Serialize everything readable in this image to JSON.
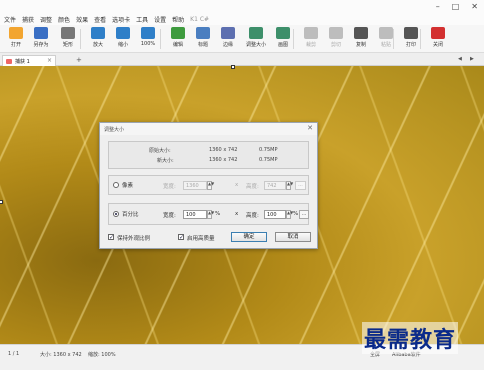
{
  "window": {
    "controls": [
      "–",
      "□",
      "✕"
    ]
  },
  "menu": [
    {
      "label": "文件",
      "dim": false
    },
    {
      "label": "捕获",
      "dim": false
    },
    {
      "label": "调整",
      "dim": false
    },
    {
      "label": "颜色",
      "dim": false
    },
    {
      "label": "效果",
      "dim": false
    },
    {
      "label": "查看",
      "dim": false
    },
    {
      "label": "选项卡",
      "dim": false
    },
    {
      "label": "工具",
      "dim": false
    },
    {
      "label": "设置",
      "dim": false
    },
    {
      "label": "帮助",
      "dim": false
    },
    {
      "label": "K1 C#",
      "dim": true
    }
  ],
  "toolbar": [
    {
      "name": "open",
      "label": "打开",
      "icon": "folder-open-icon",
      "color": "#f2a530",
      "disabled": false
    },
    {
      "name": "save-as",
      "label": "另存为",
      "icon": "save-icon",
      "color": "#3a6fc4",
      "disabled": false
    },
    {
      "name": "rect",
      "label": "矩形",
      "icon": "rect-select-icon",
      "color": "#777777",
      "disabled": false
    },
    {
      "name": "zoom-in",
      "label": "放大",
      "icon": "zoom-in-icon",
      "color": "#2f7fc8",
      "disabled": false
    },
    {
      "name": "zoom-out",
      "label": "缩小",
      "icon": "zoom-out-icon",
      "color": "#2f7fc8",
      "disabled": false
    },
    {
      "name": "zoom-100",
      "label": "100%",
      "icon": "zoom-100-icon",
      "color": "#2f7fc8",
      "disabled": false
    },
    {
      "name": "edit",
      "label": "编辑",
      "icon": "edit-icon",
      "color": "#3e9b3e",
      "disabled": false
    },
    {
      "name": "title",
      "label": "标题",
      "icon": "title-icon",
      "color": "#4a7ec0",
      "disabled": false
    },
    {
      "name": "border",
      "label": "边缘",
      "icon": "border-icon",
      "color": "#5d6fb0",
      "disabled": false
    },
    {
      "name": "resize",
      "label": "调整大小",
      "icon": "resize-icon",
      "color": "#3d8f6a",
      "disabled": false
    },
    {
      "name": "canvas",
      "label": "画图",
      "icon": "canvas-icon",
      "color": "#3d8f6a",
      "disabled": false
    },
    {
      "name": "crop",
      "label": "裁剪",
      "icon": "crop-icon",
      "color": "#777777",
      "disabled": true
    },
    {
      "name": "cut",
      "label": "剪切",
      "icon": "cut-icon",
      "color": "#777777",
      "disabled": true
    },
    {
      "name": "copy",
      "label": "复制",
      "icon": "copy-icon",
      "color": "#555555",
      "disabled": false
    },
    {
      "name": "paste",
      "label": "粘贴",
      "icon": "paste-icon",
      "color": "#777777",
      "disabled": true
    },
    {
      "name": "print",
      "label": "打印",
      "icon": "print-icon",
      "color": "#555555",
      "disabled": false
    },
    {
      "name": "close",
      "label": "关闭",
      "icon": "close-circle-icon",
      "color": "#d33030",
      "disabled": false
    }
  ],
  "tabs": {
    "doc_tab": "捕获 1",
    "add": "+",
    "nav_left": "◀",
    "nav_right": "▶"
  },
  "dialog": {
    "title": "调整大小",
    "close": "✕",
    "original_size_label": "原始大小:",
    "original_size_value": "1360 x 742",
    "original_size_mp": "0.75MP",
    "new_size_label": "新大小:",
    "new_size_value": "1360 x 742",
    "new_size_mp": "0.75MP",
    "pixels_label": "像素",
    "pixels_width_label": "宽度:",
    "pixels_width_value": "1360",
    "pixels_x": "x",
    "pixels_height_label": "高度:",
    "pixels_height_value": "742",
    "ellipsis": "...",
    "percent_label": "百分比",
    "percent_width_label": "宽度:",
    "percent_width_value": "100",
    "percent_unit": "%",
    "percent_x": "x",
    "percent_height_label": "高度:",
    "percent_height_value": "100",
    "percent_unit2": "%",
    "keep_ratio_label": "保持外观比例",
    "high_quality_label": "启用高质量",
    "ok_label": "确定",
    "cancel_label": "取消"
  },
  "status": {
    "page": "1 / 1",
    "size": "大小: 1360 x 742",
    "zoom": "缩放: 100%",
    "app": "全屏",
    "brand": "Alibaba软件"
  },
  "watermark": "最需教育"
}
